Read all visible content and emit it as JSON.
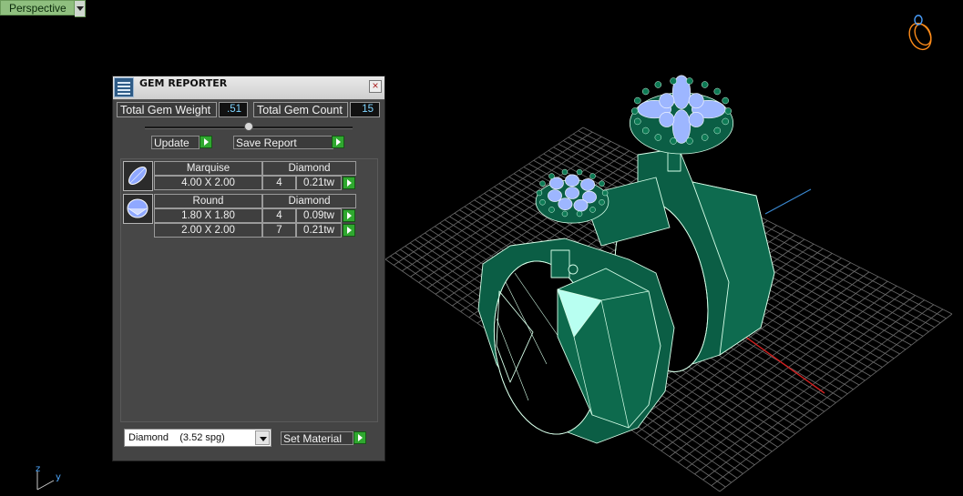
{
  "viewport": {
    "name": "Perspective"
  },
  "panel": {
    "title": "GEM REPORTER",
    "total_weight_label": "Total Gem Weight",
    "total_weight_value": ".51",
    "total_count_label": "Total Gem Count",
    "total_count_value": "15",
    "update_label": "Update",
    "save_report_label": "Save Report",
    "groups": [
      {
        "shape": "Marquise",
        "material": "Diamond",
        "rows": [
          {
            "size": "4.00 X 2.00",
            "count": "4",
            "weight": "0.21tw"
          }
        ]
      },
      {
        "shape": "Round",
        "material": "Diamond",
        "rows": [
          {
            "size": "1.80 X 1.80",
            "count": "4",
            "weight": "0.09tw"
          },
          {
            "size": "2.00 X 2.00",
            "count": "7",
            "weight": "0.21tw"
          }
        ]
      }
    ],
    "material_select": "Diamond    (3.52 spg)",
    "set_material_label": "Set Material"
  },
  "axis": {
    "z": "z",
    "y": "y"
  },
  "colors": {
    "ring": "#0b5e45",
    "ring_edge": "#d6ffe9",
    "gem": "#9db6ff",
    "grid": "#6f6f6f",
    "accent_go": "#2fa82f"
  }
}
